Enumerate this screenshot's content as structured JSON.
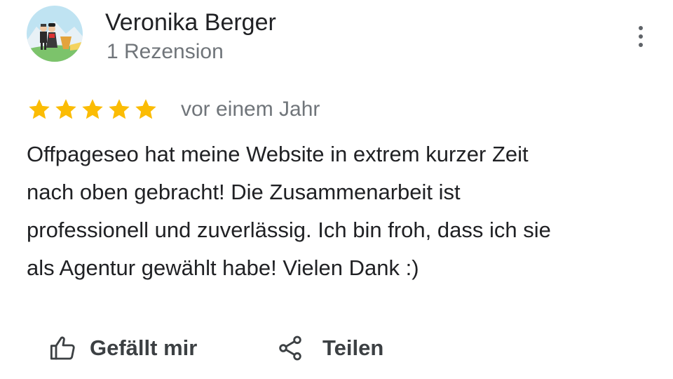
{
  "review": {
    "author": {
      "name": "Veronika Berger",
      "review_count": "1 Rezension",
      "avatar_icon": "profile-photo-avatar"
    },
    "menu_icon": "more-vert-icon",
    "rating": 5,
    "rating_max": 5,
    "star_color": "#fbbc04",
    "date": "vor einem Jahr",
    "text_lines": [
      "Offpageseo hat meine Website in extrem kurzer Zeit",
      "nach oben gebracht! Die Zusammenarbeit ist",
      "professionell und zuverlässig. Ich bin froh, dass ich sie",
      "als Agentur gewählt habe! Vielen Dank :)"
    ]
  },
  "actions": {
    "like": {
      "label": "Gefällt mir",
      "icon": "thumb-up-icon"
    },
    "share": {
      "label": "Teilen",
      "icon": "share-icon"
    }
  }
}
